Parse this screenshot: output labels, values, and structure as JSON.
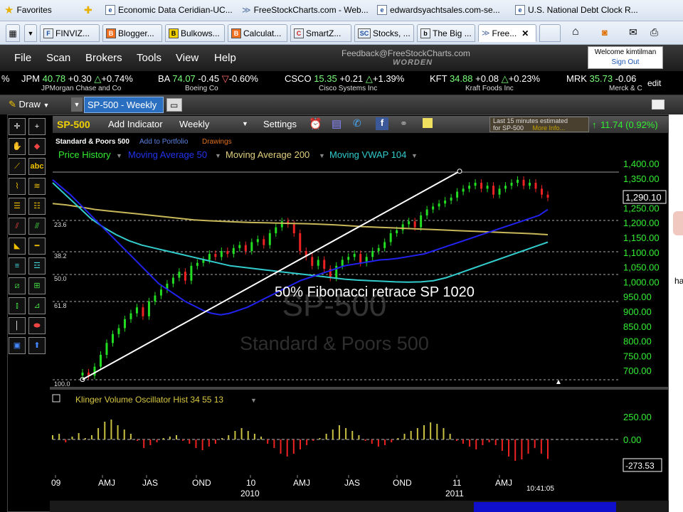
{
  "favorites_bar": {
    "favorites_label": "Favorites",
    "items": [
      {
        "label": "Economic Data  Ceridian-UC..."
      },
      {
        "label": "FreeStockCharts.com - Web..."
      },
      {
        "label": "edwardsyachtsales.com-se..."
      },
      {
        "label": "U.S. National Debt Clock  R..."
      }
    ]
  },
  "browser_tabs": [
    {
      "label": "FINVIZ...",
      "icon": "F"
    },
    {
      "label": "Blogger...",
      "icon": "B"
    },
    {
      "label": "Bulkows...",
      "icon": "B"
    },
    {
      "label": "Calculat...",
      "icon": "B"
    },
    {
      "label": "SmartZ...",
      "icon": "C"
    },
    {
      "label": "Stocks, ...",
      "icon": "SC"
    },
    {
      "label": "The Big ...",
      "icon": "b"
    },
    {
      "label": "Free...",
      "icon": "≫",
      "active": true
    }
  ],
  "app_menu": {
    "items": [
      "File",
      "Scan",
      "Brokers",
      "Tools",
      "View",
      "Help"
    ],
    "feedback": "Feedback@FreeStockCharts.com",
    "brand": "WORDEN",
    "welcome": "Welcome kimtilman",
    "sign_out": "Sign Out"
  },
  "ticker": [
    {
      "sym": "%",
      "price": "",
      "chg": "",
      "pct": "",
      "dir": "",
      "name": ""
    },
    {
      "sym": "JPM",
      "price": "40.78",
      "chg": "+0.30",
      "pct": "+0.74%",
      "dir": "up",
      "name": "JPMorgan Chase and Co"
    },
    {
      "sym": "BA",
      "price": "74.07",
      "chg": "-0.45",
      "pct": "-0.60%",
      "dir": "dn",
      "name": "Boeing Co"
    },
    {
      "sym": "CSCO",
      "price": "15.35",
      "chg": "+0.21",
      "pct": "+1.39%",
      "dir": "up",
      "name": "Cisco Systems Inc"
    },
    {
      "sym": "KFT",
      "price": "34.88",
      "chg": "+0.08",
      "pct": "+0.23%",
      "dir": "up",
      "name": "Kraft Foods Inc"
    },
    {
      "sym": "MRK",
      "price": "35.73",
      "chg": "-0.06",
      "pct": "",
      "dir": "dn",
      "name": "Merck & C"
    }
  ],
  "ticker_edit": "edit",
  "toolrow": {
    "draw": "Draw",
    "chart_tab": "SP-500 - Weekly"
  },
  "chart_header": {
    "symbol": "SP-500",
    "add_indicator": "Add Indicator",
    "period": "Weekly",
    "settings": "Settings",
    "estimated_line1": "Last 15 minutes estimated",
    "estimated_line2": "for SP-500",
    "more_info": "More Info...",
    "change": "11.74 (0.92%)",
    "name": "Standard & Poors 500",
    "add_to_portfolio": "Add to Portfolio",
    "drawings": "Drawings"
  },
  "legend": {
    "price_history": "Price History",
    "ma50": "Moving Average 50",
    "ma200": "Moving Average 200",
    "vwap": "Moving VWAP 104"
  },
  "colors": {
    "up_candle": "#22dd22",
    "down_candle": "#ee2222",
    "ma50": "#2222ee",
    "ma200": "#c8b85a",
    "vwap": "#33cccc",
    "price_axis": "#33ee33",
    "osc": "#c8c040",
    "osc_neg": "#ee2222"
  },
  "watermark": {
    "symbol": "SP-500",
    "name": "Standard & Poors 500"
  },
  "annotation": "50% Fibonacci retrace SP 1020",
  "fib_levels": [
    "23.6",
    "38.2",
    "50.0",
    "61.8",
    "100.0"
  ],
  "last_price": "1,290.10",
  "price_ticks": [
    "1,400.00",
    "1,350.00",
    "1,300.00",
    "1,250.00",
    "1,200.00",
    "1,150.00",
    "1,100.00",
    "1,050.00",
    "1,000.00",
    "950.00",
    "900.00",
    "850.00",
    "800.00",
    "750.00",
    "700.00"
  ],
  "oscillator": {
    "title": "Klinger Volume Oscillator Hist 34 55 13",
    "ticks": [
      "250.00",
      "0.00"
    ],
    "last_value": "-273.53"
  },
  "time_axis": {
    "labels": [
      "09",
      "AMJ",
      "JAS",
      "OND",
      "10",
      "AMJ",
      "JAS",
      "OND",
      "11",
      "AMJ"
    ],
    "years": [
      "2010",
      "2011"
    ],
    "clock": "10:41:05"
  },
  "right_edge_text": "ha",
  "chart_data": {
    "type": "candlestick",
    "title": "SP-500 - Weekly",
    "ylabel": "",
    "ylim": [
      700,
      1400
    ],
    "x_labels": [
      "09",
      "AMJ",
      "JAS",
      "OND",
      "10",
      "AMJ",
      "JAS",
      "OND",
      "11",
      "AMJ"
    ],
    "closes": [
      700,
      690,
      720,
      760,
      800,
      830,
      850,
      880,
      900,
      920,
      890,
      940,
      960,
      980,
      1000,
      1020,
      1040,
      1010,
      1060,
      1070,
      1080,
      1100,
      1090,
      1110,
      1100,
      1120,
      1130,
      1110,
      1140,
      1150,
      1130,
      1170,
      1190,
      1210,
      1200,
      1170,
      1110,
      1090,
      1060,
      1080,
      1050,
      1020,
      1060,
      1080,
      1090,
      1100,
      1070,
      1090,
      1110,
      1120,
      1140,
      1170,
      1180,
      1200,
      1210,
      1190,
      1230,
      1250,
      1260,
      1270,
      1280,
      1290,
      1310,
      1320,
      1330,
      1340,
      1320,
      1330,
      1300,
      1320,
      1330,
      1340,
      1350,
      1330,
      1340,
      1320,
      1300,
      1290
    ],
    "ma50": [
      1350,
      1325,
      1300,
      1270,
      1240,
      1210,
      1180,
      1150,
      1120,
      1090,
      1060,
      1030,
      1000,
      980,
      960,
      940,
      925,
      910,
      900,
      895,
      900,
      910,
      920,
      935,
      950,
      965,
      980,
      995,
      1010,
      1020,
      1030,
      1040,
      1050,
      1060,
      1065,
      1070,
      1075,
      1080,
      1082,
      1085,
      1090,
      1095,
      1100,
      1110,
      1120,
      1130,
      1140,
      1150,
      1160,
      1170,
      1180,
      1190,
      1200,
      1210,
      1220,
      1230,
      1250
    ],
    "ma200": [
      1270,
      1265,
      1258,
      1250,
      1245,
      1240,
      1235,
      1230,
      1225,
      1220,
      1215,
      1212,
      1210,
      1208,
      1206,
      1205,
      1204,
      1203,
      1202,
      1200,
      1198,
      1195,
      1192,
      1190,
      1188,
      1186,
      1184,
      1182,
      1180,
      1178,
      1176,
      1174,
      1172,
      1170,
      1168,
      1165
    ],
    "vwap": [
      1340,
      1300,
      1260,
      1220,
      1190,
      1165,
      1145,
      1130,
      1120,
      1110,
      1100,
      1090,
      1080,
      1070,
      1060,
      1055,
      1050,
      1045,
      1040,
      1035,
      1030,
      1025,
      1020,
      1015,
      1012,
      1010,
      1008,
      1006,
      1005,
      1006,
      1010,
      1020,
      1035,
      1050,
      1065,
      1080,
      1095,
      1110,
      1125,
      1140
    ],
    "fib_line": {
      "from": [
        0,
        677
      ],
      "to": [
        60,
        1379
      ]
    },
    "oscillator_hist": [
      60,
      80,
      -40,
      40,
      90,
      20,
      60,
      160,
      250,
      280,
      200,
      140,
      80,
      -20,
      -120,
      -80,
      -40,
      20,
      40,
      60,
      -20,
      -60,
      -120,
      -150,
      -100,
      -60,
      20,
      60,
      120,
      160,
      120,
      80,
      40,
      -60,
      -120,
      -200,
      -240,
      -200,
      -140,
      -80,
      -20,
      20,
      80,
      140,
      200,
      160,
      120,
      60,
      -20,
      -60,
      -100,
      -80,
      -40,
      20,
      80,
      120,
      160,
      200,
      240,
      220,
      160,
      80,
      -20,
      -60,
      -100,
      -140,
      -80,
      -40,
      -80,
      -160,
      -240,
      -300,
      -280,
      -200,
      -120,
      -200,
      -273
    ]
  }
}
